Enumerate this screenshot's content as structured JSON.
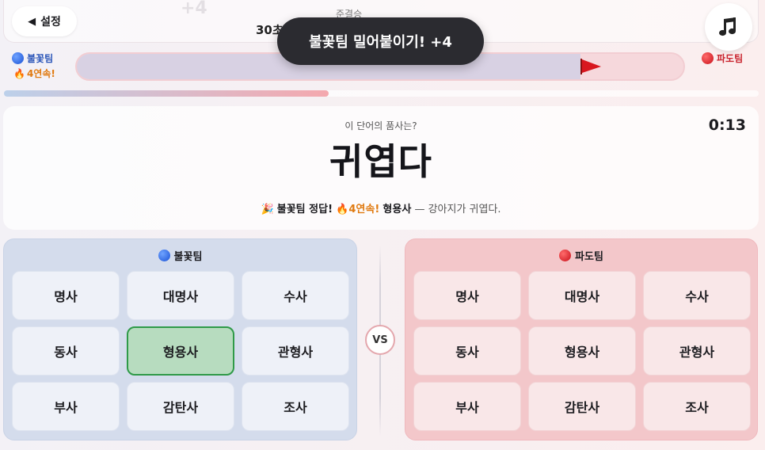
{
  "header": {
    "back_label": "설정",
    "ghost_score": "+4",
    "stage_label": "준결승",
    "goal_label": "30초",
    "music_icon": "music-note-icon"
  },
  "toast": "불꽃팀 밀어붙이기! +4",
  "rope": {
    "left_team": "불꽃팀",
    "left_streak": "4연속!",
    "right_team": "파도팀",
    "flag_position_fraction": 0.83,
    "colors": {
      "left": "#2a55b8",
      "right": "#c8232d"
    }
  },
  "timer": {
    "remaining_fraction": 0.43,
    "display": "0:13"
  },
  "question": {
    "prompt": "이 단어의 품사는?",
    "word": "귀엽다",
    "feedback": {
      "emoji": "🎉",
      "team_correct": "불꽃팀 정답!",
      "fire": "🔥",
      "streak": "4연속!",
      "answer": "형용사",
      "example": "— 강아지가 귀엽다."
    }
  },
  "panels": {
    "left": {
      "title": "불꽃팀",
      "options": [
        "명사",
        "대명사",
        "수사",
        "동사",
        "형용사",
        "관형사",
        "부사",
        "감탄사",
        "조사"
      ],
      "selected": "형용사"
    },
    "right": {
      "title": "파도팀",
      "options": [
        "명사",
        "대명사",
        "수사",
        "동사",
        "형용사",
        "관형사",
        "부사",
        "감탄사",
        "조사"
      ]
    }
  },
  "vs_label": "VS"
}
